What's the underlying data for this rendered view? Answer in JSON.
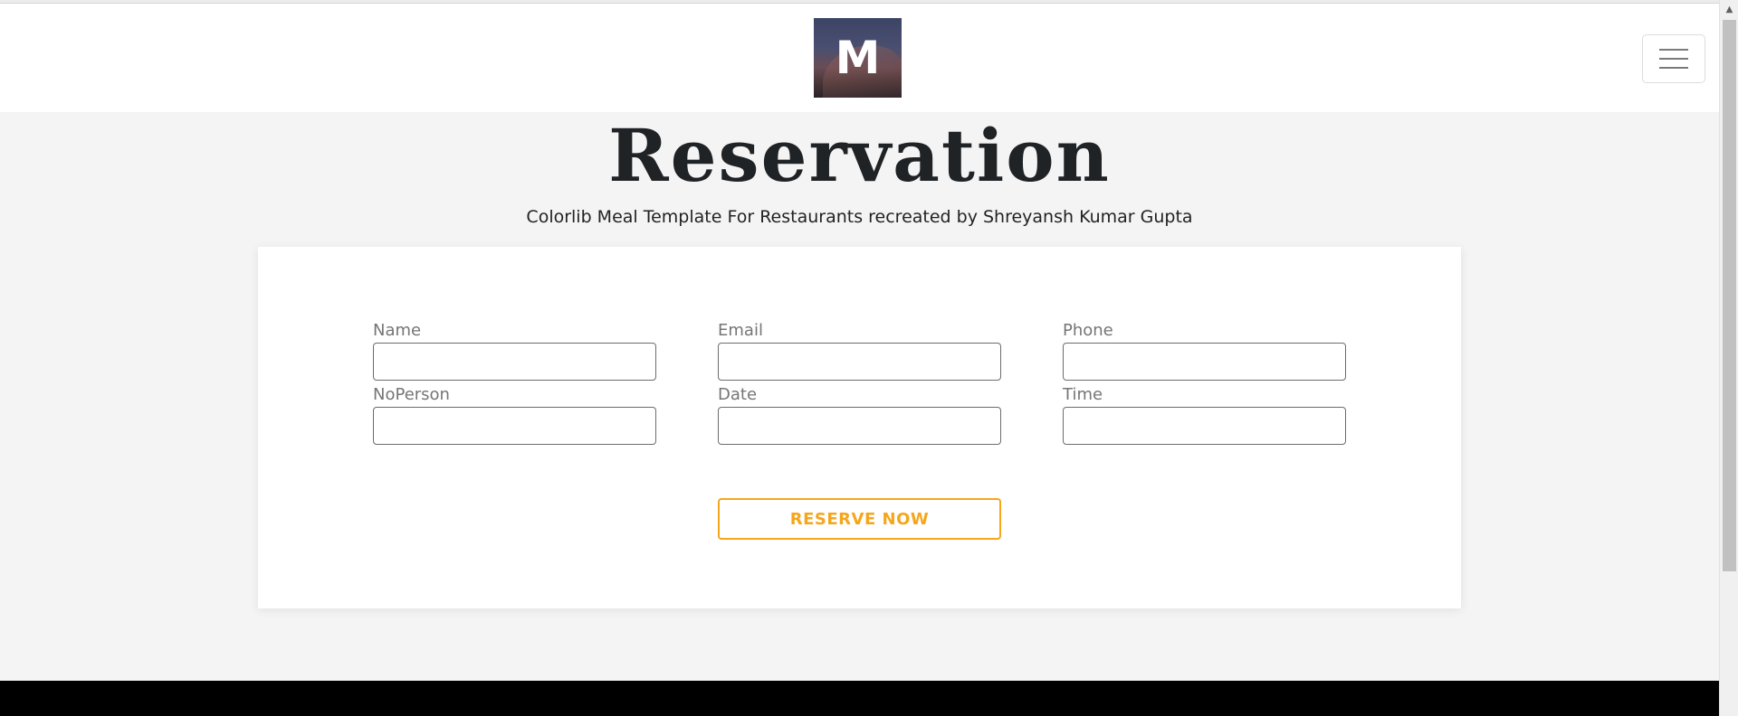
{
  "header": {
    "logo_letter": "M",
    "menu_icon": "hamburger-menu-icon"
  },
  "hero": {
    "title": "Reservation",
    "subtitle": "Colorlib Meal Template For Restaurants recreated by Shreyansh Kumar Gupta"
  },
  "form": {
    "fields": [
      {
        "label": "Name",
        "value": ""
      },
      {
        "label": "Email",
        "value": ""
      },
      {
        "label": "Phone",
        "value": ""
      },
      {
        "label": "NoPerson",
        "value": ""
      },
      {
        "label": "Date",
        "value": ""
      },
      {
        "label": "Time",
        "value": ""
      }
    ],
    "submit_label": "RESERVE NOW"
  },
  "colors": {
    "accent": "#f5a61a",
    "page_bg": "#f4f4f4",
    "footer_bg": "#000000",
    "title_text": "#1f2326"
  },
  "scrollbar": {
    "up_icon": "scroll-up-arrow-icon"
  }
}
